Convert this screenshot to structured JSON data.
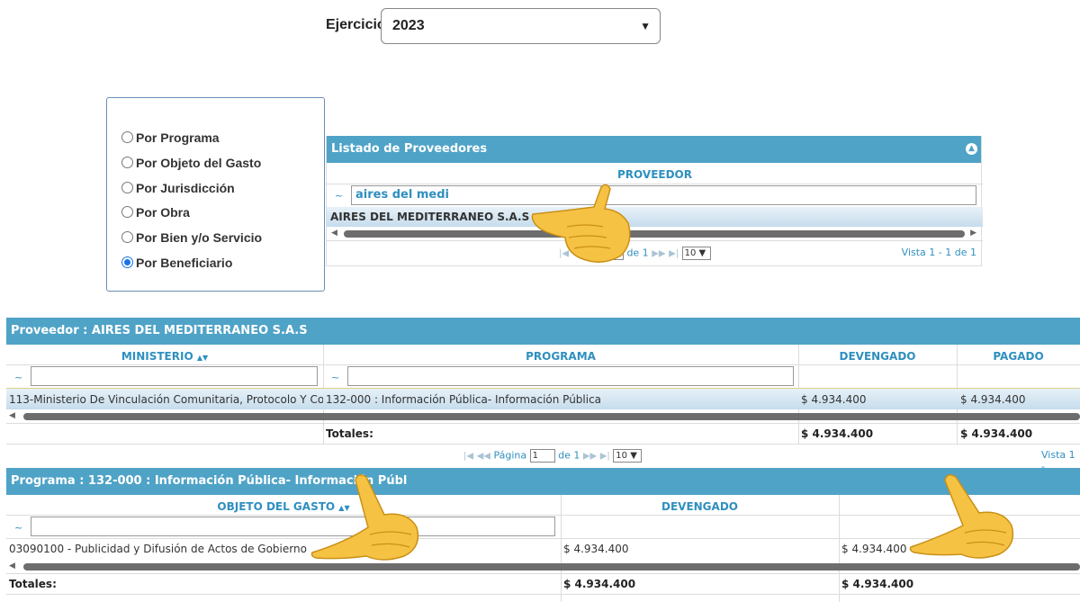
{
  "ejercicio": {
    "label": "Ejercicio:",
    "value": "2023"
  },
  "radio_options": [
    {
      "label": "Por Programa",
      "checked": false
    },
    {
      "label": "Por Objeto del Gasto",
      "checked": false
    },
    {
      "label": "Por Jurisdicción",
      "checked": false
    },
    {
      "label": "Por Obra",
      "checked": false
    },
    {
      "label": "Por Bien y/o Servicio",
      "checked": false
    },
    {
      "label": "Por Beneficiario",
      "checked": true
    }
  ],
  "proveedores": {
    "title": "Listado de Proveedores",
    "column": "PROVEEDOR",
    "filter_value": "aires del medi",
    "filter_symbol": "~",
    "row": "AIRES DEL MEDITERRANEO S.A.S",
    "pager": {
      "page": "1",
      "of": "de 1",
      "rows": "10",
      "vista": "Vista 1 - 1 de 1"
    }
  },
  "grid2": {
    "title": "Proveedor : AIRES DEL MEDITERRANEO S.A.S",
    "headers": {
      "ministerio": "MINISTERIO",
      "programa": "PROGRAMA",
      "devengado": "DEVENGADO",
      "pagado": "PAGADO"
    },
    "filter_symbol": "~",
    "row": {
      "ministerio": "113-Ministerio De Vinculación Comunitaria, Protocolo Y Co",
      "programa": "132-000 :  Información Pública- Información Pública",
      "devengado": "$ 4.934.400",
      "pagado": "$ 4.934.400"
    },
    "totals": {
      "label": "Totales:",
      "devengado": "$ 4.934.400",
      "pagado": "$ 4.934.400"
    },
    "pager": {
      "label": "Página",
      "page": "1",
      "of": "de 1",
      "rows": "10",
      "vista": "Vista 1 -"
    }
  },
  "grid3": {
    "title": "Programa : 132-000 : Información Pública- Información Públ",
    "headers": {
      "objeto": "OBJETO DEL GASTO",
      "devengado": "DEVENGADO",
      "pagado": "P"
    },
    "filter_symbol": "~",
    "row": {
      "objeto": "03090100 - Publicidad y Difusión de Actos de Gobierno",
      "devengado": "$ 4.934.400",
      "pagado": "$ 4.934.400"
    },
    "totals": {
      "label": "Totales:",
      "devengado": "$ 4.934.400",
      "pagado": "$ 4.934.400"
    }
  },
  "colors": {
    "header_blue": "#4fa3c7",
    "link_blue": "#2f8fbf",
    "row_selected": "#d6e9f5"
  },
  "icons": {
    "pointing_hand": "pointing-hand-emoji"
  }
}
